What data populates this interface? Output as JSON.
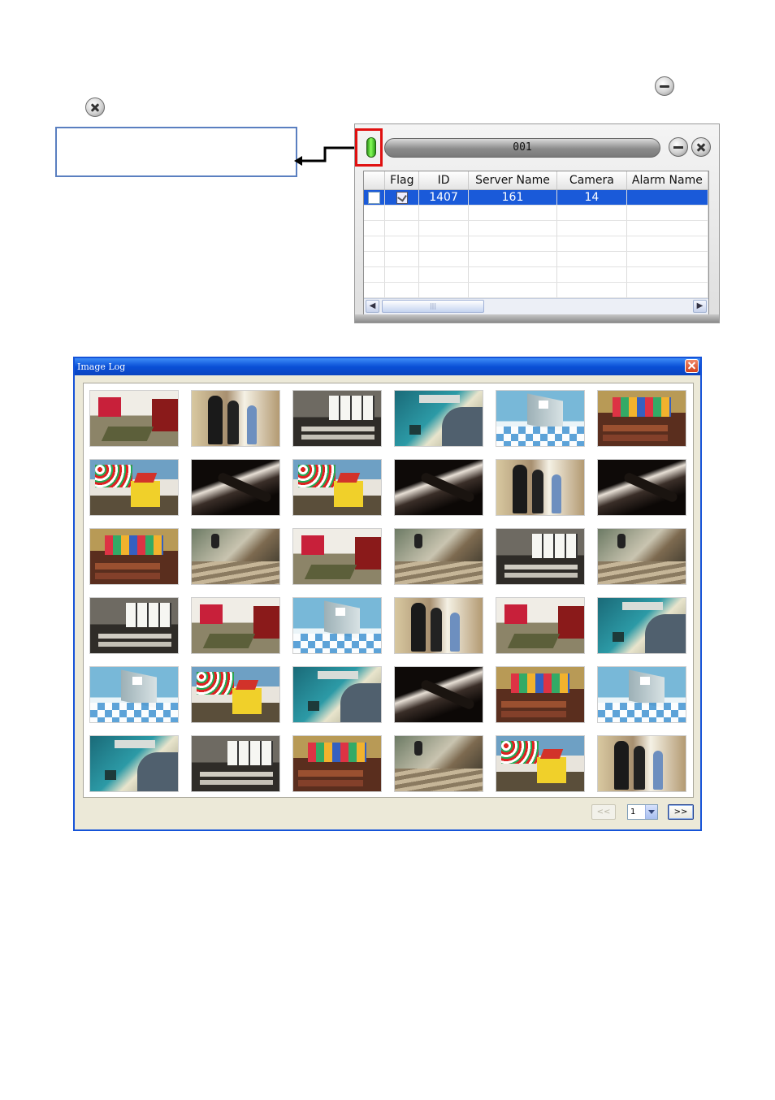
{
  "icons": {
    "minimize": "minimize-circle-icon",
    "close": "close-circle-icon",
    "status_light": "green-status-light"
  },
  "alarm_panel": {
    "title": "001",
    "columns": [
      "",
      "Flag",
      "ID",
      "Server Name",
      "Camera",
      "Alarm Name"
    ],
    "rows": [
      {
        "flag": "flag-icon",
        "id": "1407",
        "server": "161",
        "camera": "14",
        "alarm": ""
      }
    ],
    "empty_rows": 6,
    "colors": {
      "selection": "#1a5ad9",
      "alert_frame": "#e01010",
      "status_light": "#4cd22c"
    }
  },
  "image_log": {
    "title": "Image Log",
    "thumbnails": [
      "classroom-red",
      "walkers",
      "desks-bw",
      "atm",
      "elevator",
      "classroom-color",
      "playhouse",
      "shadow",
      "playhouse",
      "shadow",
      "walkers",
      "shadow",
      "classroom-color",
      "stairs",
      "classroom-red",
      "stairs",
      "desks-bw",
      "stairs",
      "desks-bw",
      "classroom-red",
      "elevator",
      "walkers",
      "classroom-red",
      "atm",
      "elevator",
      "playhouse",
      "atm",
      "shadow",
      "classroom-color",
      "elevator",
      "atm",
      "desks-bw",
      "classroom-color",
      "stairs",
      "playhouse",
      "walkers"
    ],
    "pager": {
      "prev_label": "<<",
      "page": "1",
      "next_label": ">>"
    },
    "colors": {
      "title_bar": "#0a4fd6",
      "window_bg": "#ece9d8"
    }
  }
}
